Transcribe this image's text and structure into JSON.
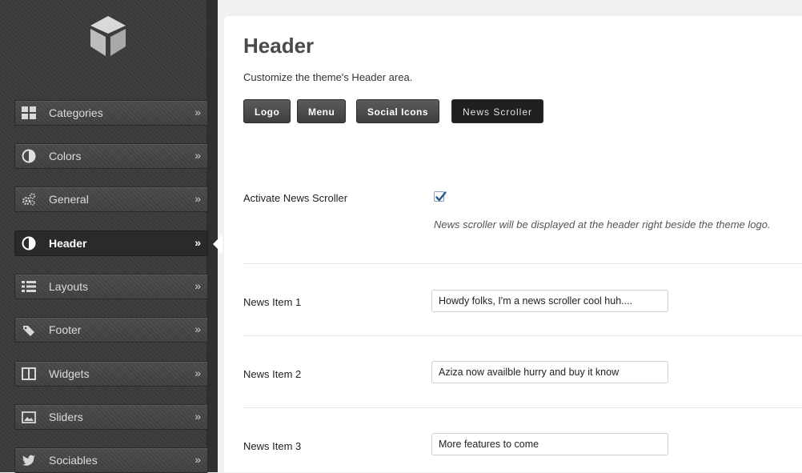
{
  "sidebar": {
    "logo_icon": "brand-logo-icon",
    "items": [
      {
        "label": "Categories",
        "icon": "grid-icon",
        "chevron": "»"
      },
      {
        "label": "Colors",
        "icon": "contrast-icon",
        "chevron": "»"
      },
      {
        "label": "General",
        "icon": "gears-icon",
        "chevron": "»"
      },
      {
        "label": "Header",
        "icon": "contrast-icon",
        "chevron": "»",
        "active": true
      },
      {
        "label": "Layouts",
        "icon": "list-icon",
        "chevron": "»"
      },
      {
        "label": "Footer",
        "icon": "tag-icon",
        "chevron": "»"
      },
      {
        "label": "Widgets",
        "icon": "columns-icon",
        "chevron": "»"
      },
      {
        "label": "Sliders",
        "icon": "image-icon",
        "chevron": "»"
      },
      {
        "label": "Sociables",
        "icon": "twitter-icon",
        "chevron": "»"
      }
    ]
  },
  "main": {
    "title": "Header",
    "description": "Customize the theme's Header area.",
    "tabs": [
      {
        "label": "Logo"
      },
      {
        "label": "Menu"
      },
      {
        "label": "Social Icons"
      },
      {
        "label": "News Scroller",
        "active": true
      }
    ],
    "activate": {
      "label": "Activate News Scroller",
      "checked": true,
      "help": "News scroller will be displayed at the header right beside the theme logo."
    },
    "news_items": [
      {
        "label": "News Item 1",
        "value": "Howdy folks, I'm a news scroller cool huh...."
      },
      {
        "label": "News Item 2",
        "value": "Aziza now availble hurry and buy it know"
      },
      {
        "label": "News Item 3",
        "value": "More features to come"
      }
    ]
  },
  "colors": {
    "sidebar_bg": "#3b3b3b",
    "active_item_bg": "#2a2a2a",
    "tab_active_bg": "#1f1f1f",
    "checkbox_check": "#2b5797"
  }
}
